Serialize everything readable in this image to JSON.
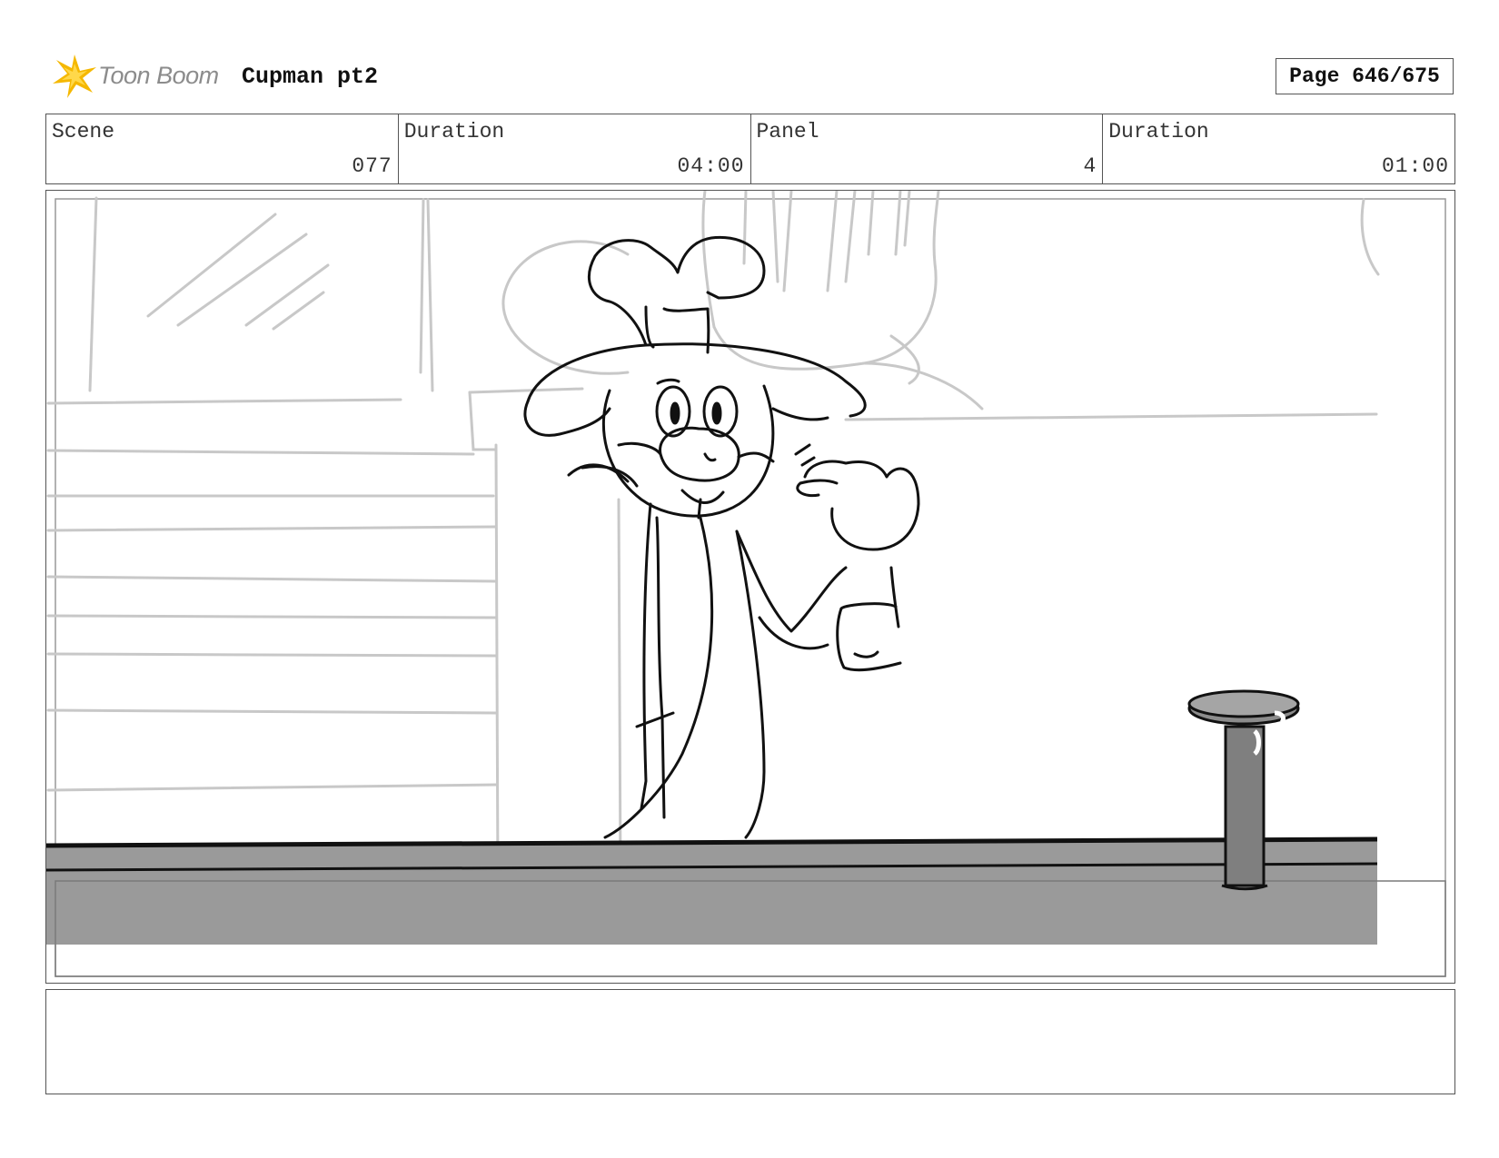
{
  "header": {
    "logo_text": "Toon Boom",
    "project_title": "Cupman pt2",
    "page_label": "Page 646/675"
  },
  "info": [
    {
      "label": "Scene",
      "value": "077"
    },
    {
      "label": "Duration",
      "value": "04:00"
    },
    {
      "label": "Panel",
      "value": "4"
    },
    {
      "label": "Duration",
      "value": "01:00"
    }
  ],
  "notes": {
    "text": ""
  },
  "colors": {
    "logo_yellow": "#f5b800",
    "sketch_gray": "#c8c8c8",
    "ink": "#111111",
    "counter_fill": "#9a9a9a"
  }
}
